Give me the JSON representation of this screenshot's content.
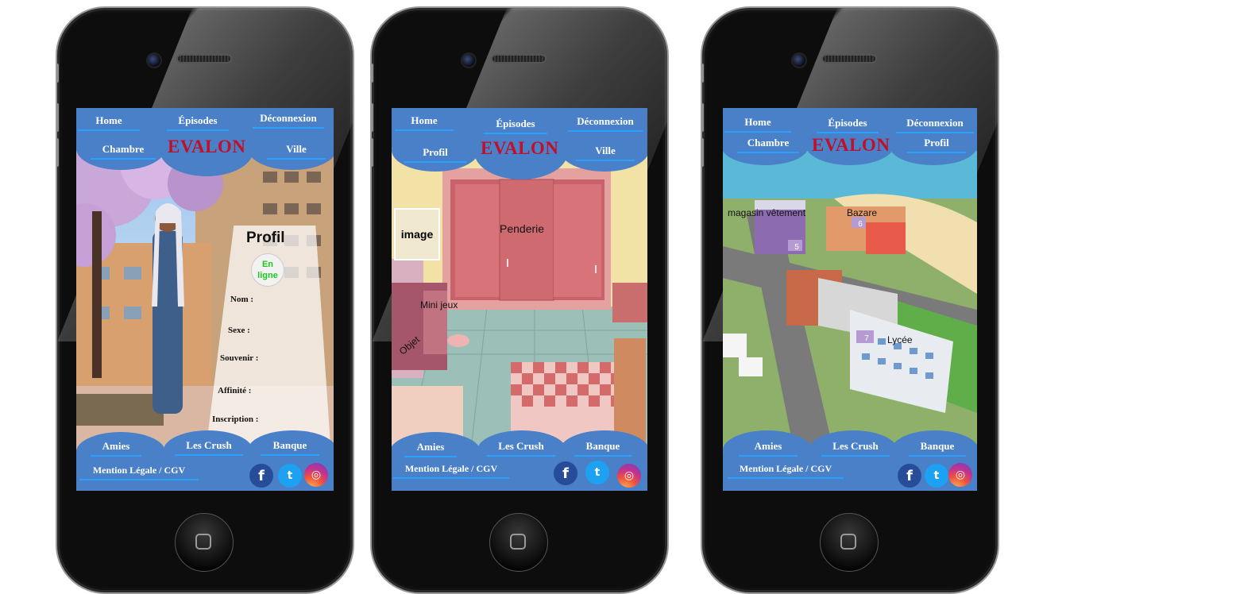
{
  "phone1": {
    "nav": {
      "home": "Home",
      "episodes": "Épisodes",
      "logout": "Déconnexion",
      "room": "Chambre",
      "city": "Ville"
    },
    "logo": "EVALON",
    "profile": {
      "title": "Profil",
      "status": "En ligne",
      "fields": [
        "Nom :",
        "Sexe :",
        "Souvenir :",
        "Affinité :",
        "Inscription :"
      ]
    },
    "bottom": {
      "friends": "Amies",
      "crush": "Les Crush",
      "bank": "Banque",
      "legal": "Mention Légale / CGV"
    }
  },
  "phone2": {
    "nav": {
      "home": "Home",
      "episodes": "Épisodes",
      "logout": "Déconnexion",
      "profile": "Profil",
      "city": "Ville"
    },
    "logo": "EVALON",
    "room": {
      "image": "image",
      "wardrobe": "Penderie",
      "minigames": "Mini jeux",
      "object": "Objet"
    },
    "bottom": {
      "friends": "Amies",
      "crush": "Les Crush",
      "bank": "Banque",
      "legal": "Mention Légale / CGV"
    }
  },
  "phone3": {
    "nav": {
      "home": "Home",
      "episodes": "Épisodes",
      "logout": "Déconnexion",
      "room": "Chambre",
      "profile": "Profil"
    },
    "logo": "EVALON",
    "city": {
      "clothes": "magasin vêtement",
      "bazaar": "Bazare",
      "school": "Lycée",
      "marker5": "5",
      "marker6": "6",
      "marker7": "7"
    },
    "bottom": {
      "friends": "Amies",
      "crush": "Les Crush",
      "bank": "Banque",
      "legal": "Mention Légale / CGV"
    }
  },
  "colors": {
    "bar": "#4a80c8",
    "underline": "#2aa0ff",
    "logo": "#c0102a",
    "online": "#1ec81e"
  },
  "icons": [
    "facebook-icon",
    "twitter-icon",
    "instagram-icon"
  ]
}
